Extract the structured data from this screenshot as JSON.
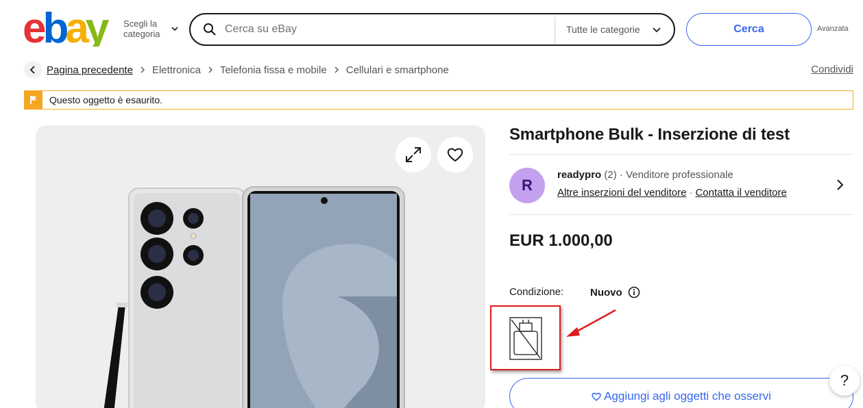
{
  "header": {
    "shop_by_category": "Scegli la categoria",
    "search_placeholder": "Cerca su eBay",
    "category_select": "Tutte le categorie",
    "search_button": "Cerca",
    "advanced": "Avanzata"
  },
  "breadcrumb": {
    "back": "Pagina precedente",
    "items": [
      "Elettronica",
      "Telefonia fissa e mobile",
      "Cellulari e smartphone"
    ],
    "share": "Condividi"
  },
  "alert": {
    "text": "Questo oggetto è esaurito."
  },
  "listing": {
    "title": "Smartphone Bulk - Inserzione di test",
    "price": "EUR 1.000,00",
    "condition_label": "Condizione:",
    "condition_value": "Nuovo",
    "watch_button": "Aggiungi agli oggetti che osservi"
  },
  "seller": {
    "initial": "R",
    "name": "readypro",
    "feedback": "(2)",
    "separator": "·",
    "type": "Venditore professionale",
    "other_listings": "Altre inserzioni del venditore",
    "contact": "Contatta il venditore"
  },
  "help": {
    "label": "?"
  },
  "colors": {
    "accent": "#3665f3",
    "alert_border": "#f5a623",
    "avatar_bg": "#c4a1ef",
    "annotation_red": "#e01b1b"
  }
}
